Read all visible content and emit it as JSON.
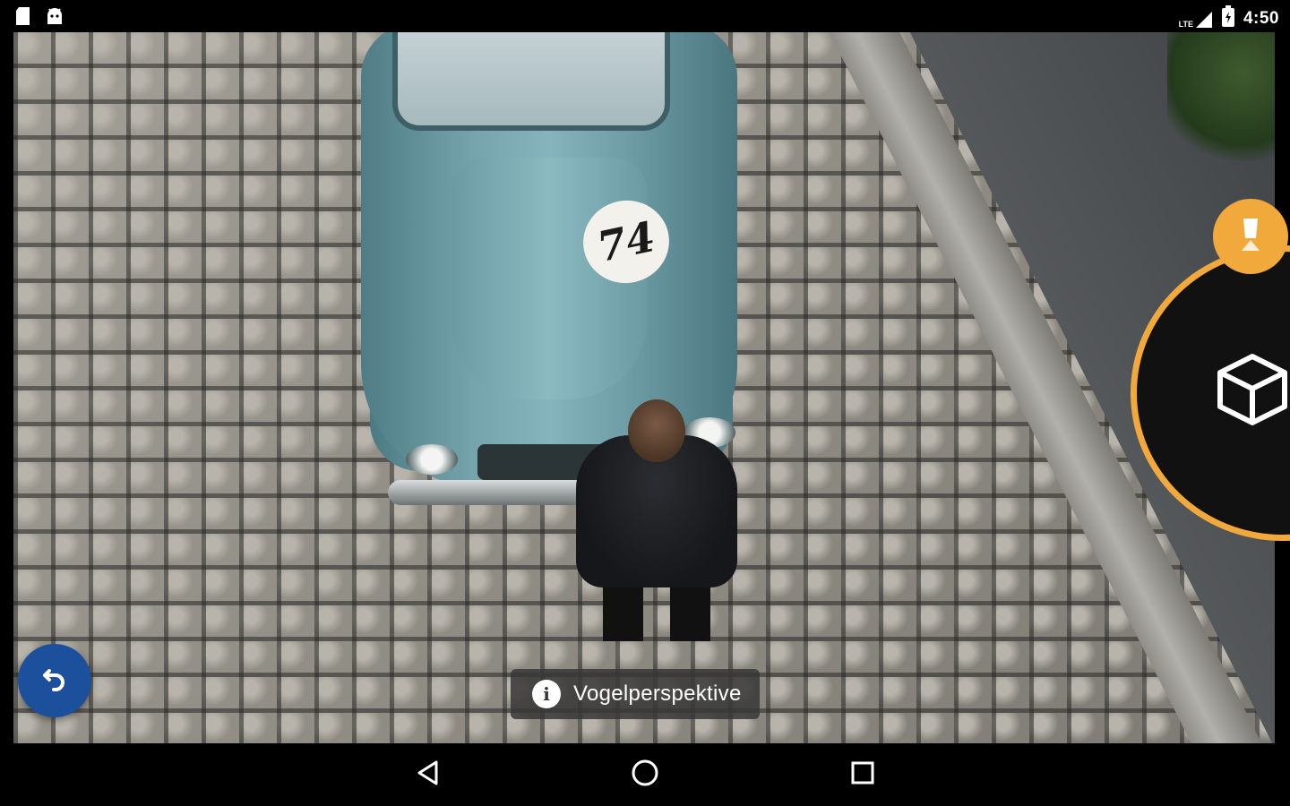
{
  "status_bar": {
    "time": "4:50",
    "network_label": "LTE",
    "left_icons": [
      "sd-card-icon",
      "android-debug-icon"
    ],
    "right_icons": [
      "signal-icon",
      "battery-icon"
    ]
  },
  "photo": {
    "car_number": "74"
  },
  "toast": {
    "text": "Vogelperspektive",
    "icon": "info-icon"
  },
  "mode_wheel": {
    "current_icon": "cube-icon",
    "handle_icon": "drone-mode-icon",
    "accent_color": "#f2a93b"
  },
  "back_fab": {
    "icon": "undo-icon",
    "color": "#1c4f9c"
  },
  "nav_bar": {
    "buttons": [
      "back-icon",
      "home-icon",
      "recents-icon"
    ]
  }
}
